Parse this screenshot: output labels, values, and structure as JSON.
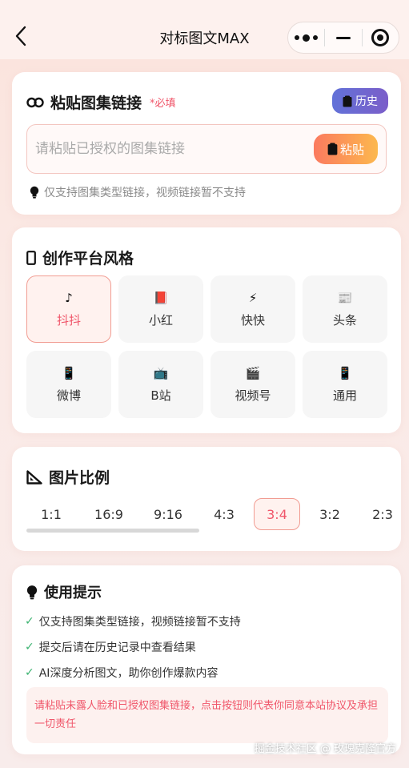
{
  "nav": {
    "title": "对标图文MAX"
  },
  "link_card": {
    "icon": "link-icon",
    "title": "粘贴图集链接",
    "required": "*必填",
    "history_label": "历史",
    "input_placeholder": "请粘贴已授权的图集链接",
    "input_value": "",
    "paste_label": "粘贴",
    "hint": "仅支持图集类型链接，视频链接暂不支持"
  },
  "platform_card": {
    "title": "创作平台风格",
    "selected": "抖抖",
    "items": [
      {
        "label": "抖抖",
        "icon": "♪"
      },
      {
        "label": "小红",
        "icon": "📕"
      },
      {
        "label": "快快",
        "icon": "⚡"
      },
      {
        "label": "头条",
        "icon": "📰"
      },
      {
        "label": "微博",
        "icon": "📱"
      },
      {
        "label": "B站",
        "icon": "📺"
      },
      {
        "label": "视频号",
        "icon": "🎬"
      },
      {
        "label": "通用",
        "icon": "📱"
      }
    ]
  },
  "ratio_card": {
    "title": "图片比例",
    "selected": "3:4",
    "items": [
      "1:1",
      "16:9",
      "9:16",
      "4:3",
      "3:4",
      "3:2",
      "2:3"
    ]
  },
  "tips_card": {
    "title": "使用提示",
    "tips": [
      "仅支持图集类型链接，视频链接暂不支持",
      "提交后请在历史记录中查看结果",
      "AI深度分析图文，助你创作爆款内容"
    ],
    "warning": "请粘贴未露人脸和已授权图集链接，点击按钮则代表你同意本站协议及承担一切责任"
  },
  "watermark": "掘金技术社区 @ 玫瑰克隆官方",
  "colors": {
    "accent": "#f0566a",
    "history_gradient": [
      "#6272d8",
      "#7b5ec9"
    ],
    "paste_gradient": [
      "#fb7a5f",
      "#fcb84e"
    ],
    "check": "#3cb371"
  }
}
